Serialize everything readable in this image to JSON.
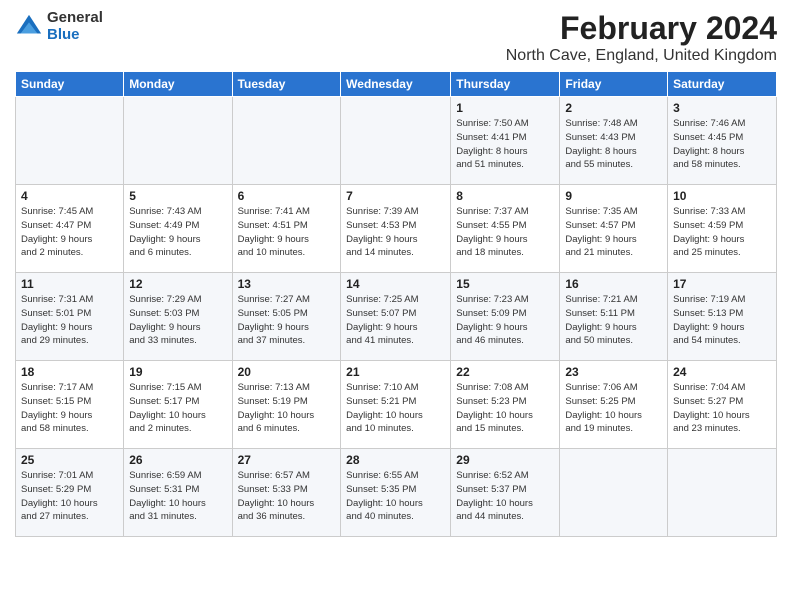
{
  "logo": {
    "general": "General",
    "blue": "Blue"
  },
  "title": "February 2024",
  "subtitle": "North Cave, England, United Kingdom",
  "days_of_week": [
    "Sunday",
    "Monday",
    "Tuesday",
    "Wednesday",
    "Thursday",
    "Friday",
    "Saturday"
  ],
  "weeks": [
    [
      {
        "day": "",
        "info": ""
      },
      {
        "day": "",
        "info": ""
      },
      {
        "day": "",
        "info": ""
      },
      {
        "day": "",
        "info": ""
      },
      {
        "day": "1",
        "info": "Sunrise: 7:50 AM\nSunset: 4:41 PM\nDaylight: 8 hours\nand 51 minutes."
      },
      {
        "day": "2",
        "info": "Sunrise: 7:48 AM\nSunset: 4:43 PM\nDaylight: 8 hours\nand 55 minutes."
      },
      {
        "day": "3",
        "info": "Sunrise: 7:46 AM\nSunset: 4:45 PM\nDaylight: 8 hours\nand 58 minutes."
      }
    ],
    [
      {
        "day": "4",
        "info": "Sunrise: 7:45 AM\nSunset: 4:47 PM\nDaylight: 9 hours\nand 2 minutes."
      },
      {
        "day": "5",
        "info": "Sunrise: 7:43 AM\nSunset: 4:49 PM\nDaylight: 9 hours\nand 6 minutes."
      },
      {
        "day": "6",
        "info": "Sunrise: 7:41 AM\nSunset: 4:51 PM\nDaylight: 9 hours\nand 10 minutes."
      },
      {
        "day": "7",
        "info": "Sunrise: 7:39 AM\nSunset: 4:53 PM\nDaylight: 9 hours\nand 14 minutes."
      },
      {
        "day": "8",
        "info": "Sunrise: 7:37 AM\nSunset: 4:55 PM\nDaylight: 9 hours\nand 18 minutes."
      },
      {
        "day": "9",
        "info": "Sunrise: 7:35 AM\nSunset: 4:57 PM\nDaylight: 9 hours\nand 21 minutes."
      },
      {
        "day": "10",
        "info": "Sunrise: 7:33 AM\nSunset: 4:59 PM\nDaylight: 9 hours\nand 25 minutes."
      }
    ],
    [
      {
        "day": "11",
        "info": "Sunrise: 7:31 AM\nSunset: 5:01 PM\nDaylight: 9 hours\nand 29 minutes."
      },
      {
        "day": "12",
        "info": "Sunrise: 7:29 AM\nSunset: 5:03 PM\nDaylight: 9 hours\nand 33 minutes."
      },
      {
        "day": "13",
        "info": "Sunrise: 7:27 AM\nSunset: 5:05 PM\nDaylight: 9 hours\nand 37 minutes."
      },
      {
        "day": "14",
        "info": "Sunrise: 7:25 AM\nSunset: 5:07 PM\nDaylight: 9 hours\nand 41 minutes."
      },
      {
        "day": "15",
        "info": "Sunrise: 7:23 AM\nSunset: 5:09 PM\nDaylight: 9 hours\nand 46 minutes."
      },
      {
        "day": "16",
        "info": "Sunrise: 7:21 AM\nSunset: 5:11 PM\nDaylight: 9 hours\nand 50 minutes."
      },
      {
        "day": "17",
        "info": "Sunrise: 7:19 AM\nSunset: 5:13 PM\nDaylight: 9 hours\nand 54 minutes."
      }
    ],
    [
      {
        "day": "18",
        "info": "Sunrise: 7:17 AM\nSunset: 5:15 PM\nDaylight: 9 hours\nand 58 minutes."
      },
      {
        "day": "19",
        "info": "Sunrise: 7:15 AM\nSunset: 5:17 PM\nDaylight: 10 hours\nand 2 minutes."
      },
      {
        "day": "20",
        "info": "Sunrise: 7:13 AM\nSunset: 5:19 PM\nDaylight: 10 hours\nand 6 minutes."
      },
      {
        "day": "21",
        "info": "Sunrise: 7:10 AM\nSunset: 5:21 PM\nDaylight: 10 hours\nand 10 minutes."
      },
      {
        "day": "22",
        "info": "Sunrise: 7:08 AM\nSunset: 5:23 PM\nDaylight: 10 hours\nand 15 minutes."
      },
      {
        "day": "23",
        "info": "Sunrise: 7:06 AM\nSunset: 5:25 PM\nDaylight: 10 hours\nand 19 minutes."
      },
      {
        "day": "24",
        "info": "Sunrise: 7:04 AM\nSunset: 5:27 PM\nDaylight: 10 hours\nand 23 minutes."
      }
    ],
    [
      {
        "day": "25",
        "info": "Sunrise: 7:01 AM\nSunset: 5:29 PM\nDaylight: 10 hours\nand 27 minutes."
      },
      {
        "day": "26",
        "info": "Sunrise: 6:59 AM\nSunset: 5:31 PM\nDaylight: 10 hours\nand 31 minutes."
      },
      {
        "day": "27",
        "info": "Sunrise: 6:57 AM\nSunset: 5:33 PM\nDaylight: 10 hours\nand 36 minutes."
      },
      {
        "day": "28",
        "info": "Sunrise: 6:55 AM\nSunset: 5:35 PM\nDaylight: 10 hours\nand 40 minutes."
      },
      {
        "day": "29",
        "info": "Sunrise: 6:52 AM\nSunset: 5:37 PM\nDaylight: 10 hours\nand 44 minutes."
      },
      {
        "day": "",
        "info": ""
      },
      {
        "day": "",
        "info": ""
      }
    ]
  ]
}
